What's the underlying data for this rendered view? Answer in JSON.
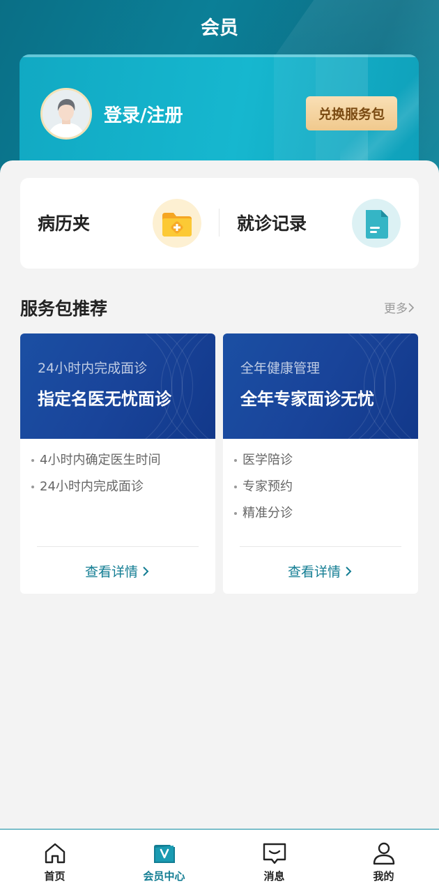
{
  "header": {
    "title": "会员"
  },
  "member_card": {
    "login_label": "登录/注册",
    "redeem_label": "兑换服务包"
  },
  "quick_actions": [
    {
      "label": "病历夹",
      "icon": "folder-icon"
    },
    {
      "label": "就诊记录",
      "icon": "document-icon"
    }
  ],
  "services": {
    "title": "服务包推荐",
    "more_label": "更多",
    "packages": [
      {
        "subtitle": "24小时内完成面诊",
        "title": "指定名医无忧面诊",
        "features": [
          "4小时内确定医生时间",
          "24小时内完成面诊"
        ],
        "detail_label": "查看详情"
      },
      {
        "subtitle": "全年健康管理",
        "title": "全年专家面诊无忧",
        "features": [
          "医学陪诊",
          "专家预约",
          "精准分诊"
        ],
        "detail_label": "查看详情"
      }
    ]
  },
  "tabbar": {
    "items": [
      {
        "label": "首页",
        "icon": "home-icon"
      },
      {
        "label": "会员中心",
        "icon": "member-center-icon",
        "active": true
      },
      {
        "label": "消息",
        "icon": "message-icon"
      },
      {
        "label": "我的",
        "icon": "profile-icon"
      }
    ]
  },
  "colors": {
    "accent": "#137d93",
    "header_teal": "#0b7f97",
    "card_teal": "#16b7cf",
    "banner_blue": "#1b4fa3",
    "gold": "#f0c98d"
  }
}
